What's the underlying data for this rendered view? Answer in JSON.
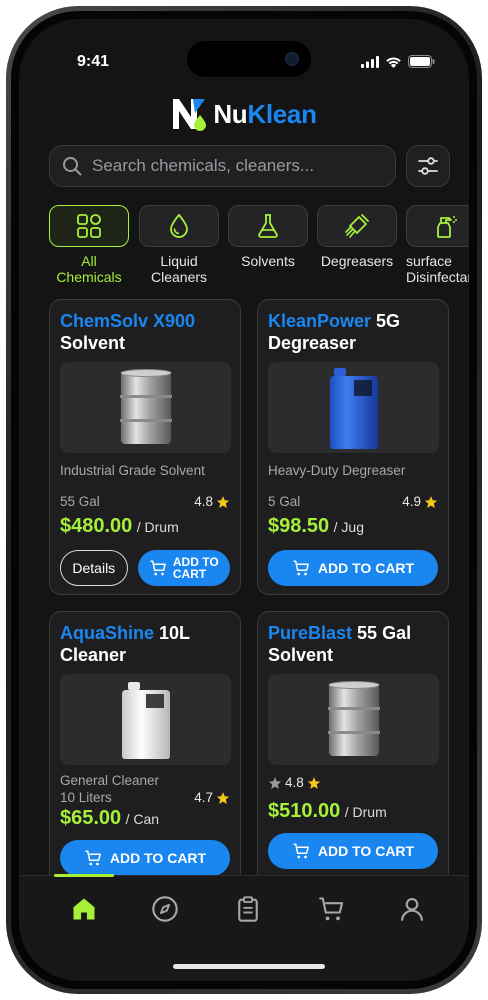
{
  "status": {
    "time": "9:41"
  },
  "app": {
    "name_part1": "Nu",
    "name_part2": "Klean"
  },
  "search": {
    "placeholder": "Search chemicals, cleaners..."
  },
  "categories": [
    {
      "label": "All\nChemicals",
      "icon": "grid-icon",
      "active": true
    },
    {
      "label": "Liquid\nCleaners",
      "icon": "droplet-icon",
      "active": false
    },
    {
      "label": "Solvents",
      "icon": "flask-icon",
      "active": false
    },
    {
      "label": "Degreasers",
      "icon": "brush-icon",
      "active": false
    },
    {
      "label": "surface\nDisinfectants",
      "icon": "spray-bottle-icon",
      "active": false
    }
  ],
  "products": [
    {
      "brand": "ChemSolv X900",
      "name_rest": " Solvent",
      "image": "steel-drum",
      "description": "Industrial Grade Solvent",
      "size": "55 Gal",
      "rating": "4.8",
      "price": "$480.00",
      "unit": "/ Drum",
      "details_label": "Details",
      "cart_label": "ADD TO\nCART"
    },
    {
      "brand": "KleanPower",
      "name_rest": " 5G Degreaser",
      "image": "blue-jug",
      "description": "Heavy-Duty Degreaser",
      "size": "5 Gal",
      "rating": "4.9",
      "price": "$98.50",
      "unit": "/ Jug",
      "cart_label": "ADD TO CART"
    },
    {
      "brand": "AquaShine",
      "name_rest": " 10L Cleaner",
      "image": "white-can",
      "description": "General Cleaner",
      "size": "10 Liters",
      "rating": "4.7",
      "price": "$65.00",
      "unit": "/ Can",
      "cart_label": "ADD TO CART"
    },
    {
      "brand": "PureBlast",
      "name_rest": " 55 Gal Solvent",
      "image": "steel-drum",
      "rating": "4.8",
      "price": "$510.00",
      "unit": "/ Drum",
      "cart_label": "ADD TO CART"
    }
  ],
  "tabs": [
    {
      "name": "home-icon",
      "active": true
    },
    {
      "name": "compass-icon",
      "active": false
    },
    {
      "name": "clipboard-icon",
      "active": false
    },
    {
      "name": "cart-icon",
      "active": false
    },
    {
      "name": "profile-icon",
      "active": false
    }
  ],
  "colors": {
    "accent_green": "#a6f03a",
    "brand_blue": "#1a86f0",
    "background": "#141414"
  }
}
